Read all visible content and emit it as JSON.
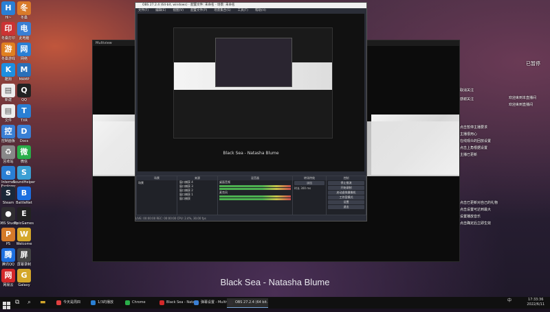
{
  "desktop_icons": [
    {
      "label": "Hi~",
      "color": "#2a7fd4",
      "glyph": "H",
      "icon": "app-icon"
    },
    {
      "label": "冬桑",
      "color": "#d97a2a",
      "glyph": "冬",
      "icon": "app-icon"
    },
    {
      "label": "冬桑打印",
      "color": "#c33",
      "glyph": "印",
      "icon": "app-icon"
    },
    {
      "label": "此电脑",
      "color": "#3a7fd4",
      "glyph": "电",
      "icon": "computer-icon"
    },
    {
      "label": "冬桑游戏",
      "color": "#e08020",
      "glyph": "游",
      "icon": "app-icon"
    },
    {
      "label": "网络",
      "color": "#2a7fd4",
      "glyph": "网",
      "icon": "network-icon"
    },
    {
      "label": "酷狗",
      "color": "#1d8fe0",
      "glyph": "K",
      "icon": "app-icon"
    },
    {
      "label": "MAMP",
      "color": "#2a6fb8",
      "glyph": "M",
      "icon": "app-icon"
    },
    {
      "label": "新建",
      "color": "#eeeeee",
      "glyph": "▤",
      "icon": "file-icon"
    },
    {
      "label": "QQ",
      "color": "#222",
      "glyph": "Q",
      "icon": "qq-icon"
    },
    {
      "label": "文件",
      "color": "#eeeeee",
      "glyph": "▤",
      "icon": "file-icon"
    },
    {
      "label": "TXR",
      "color": "#2a7fd4",
      "glyph": "T",
      "icon": "app-icon"
    },
    {
      "label": "控制面板",
      "color": "#3a7fd4",
      "glyph": "控",
      "icon": "control-panel-icon"
    },
    {
      "label": "Docs",
      "color": "#3a7fd4",
      "glyph": "D",
      "icon": "app-icon"
    },
    {
      "label": "回收站",
      "color": "#888",
      "glyph": "♻",
      "icon": "recycle-bin-icon"
    },
    {
      "label": "微信",
      "color": "#2aae4a",
      "glyph": "微",
      "icon": "wechat-icon"
    },
    {
      "label": "Internet Explorer",
      "color": "#2a7fd4",
      "glyph": "e",
      "icon": "ie-icon"
    },
    {
      "label": "SoundHelper",
      "color": "#3a9fd4",
      "glyph": "S",
      "icon": "app-icon"
    },
    {
      "label": "Steam",
      "color": "#1b2838",
      "glyph": "S",
      "icon": "steam-icon"
    },
    {
      "label": "BattleNet",
      "color": "#1d6fe0",
      "glyph": "B",
      "icon": "app-icon"
    },
    {
      "label": "OBS Studio",
      "color": "#302e31",
      "glyph": "●",
      "icon": "obs-icon"
    },
    {
      "label": "EpicGames",
      "color": "#222",
      "glyph": "E",
      "icon": "epic-icon"
    },
    {
      "label": "PS",
      "color": "#d47a2a",
      "glyph": "P",
      "icon": "app-icon"
    },
    {
      "label": "Welcome",
      "color": "#d4a72a",
      "glyph": "W",
      "icon": "app-icon"
    },
    {
      "label": "腾讯QQ",
      "color": "#1d6fe0",
      "glyph": "腾",
      "icon": "app-icon"
    },
    {
      "label": "屏幕录制",
      "color": "#444",
      "glyph": "屏",
      "icon": "app-icon"
    },
    {
      "label": "网易云",
      "color": "#d4292a",
      "glyph": "网",
      "icon": "netease-icon"
    },
    {
      "label": "Galaxy",
      "color": "#d4a72a",
      "glyph": "G",
      "icon": "app-icon"
    }
  ],
  "projector": {
    "title": "Multiview"
  },
  "obs": {
    "title": "OBS 27.2.4 (64-bit, windows) - 配置文件: 未命名 - 场景: 未命名",
    "menu": [
      "文件(F)",
      "编辑(E)",
      "视图(V)",
      "配置文件(P)",
      "场景集合(S)",
      "工具(T)",
      "帮助(H)"
    ],
    "inner_caption": "Black Sea - Natasha Blume",
    "docks": [
      "场景",
      "来源",
      "混音器",
      "转场特效",
      "控制"
    ],
    "scene_item": "场景",
    "sources": [
      "窗口捕获 4",
      "窗口捕获 3",
      "窗口捕获 2",
      "窗口捕获 1",
      "窗口捕获"
    ],
    "mixer": [
      "桌面音频",
      "麦克风"
    ],
    "transition": {
      "name": "淡出",
      "duration_label": "时长",
      "duration": "300 ms"
    },
    "controls": [
      "停止推流",
      "开始录制",
      "启动虚拟摄像机",
      "工作室模式",
      "设置",
      "退出"
    ],
    "status": "LIVE: 00:00:00  REC: 00:00:00  CPU: 2.4%, 30.00 fps"
  },
  "chat": [
    "已暂停",
    "取消关注",
    "欢迎来到本直播间",
    "感谢关注",
    "欢迎来到直播间",
    "点击暂停主播要求",
    "主播很用心",
    "在线观众的回放设置",
    "点击上角根据设置",
    "主播已更新",
    "点击已更新对自己的礼物",
    "点击设置可达到最大",
    "设置播放音乐",
    "点击确定后立即生效"
  ],
  "caption": "Black Sea - Natasha Blume",
  "taskbar": {
    "items": [
      {
        "label": "今天是周四",
        "color": "#e04040",
        "active": false
      },
      {
        "label": "1/3的播放",
        "color": "#2a7fd4",
        "active": false
      },
      {
        "label": "Chrome",
        "color": "#2aae4a",
        "active": false
      },
      {
        "label": "Black Sea - Natas…",
        "color": "#d4292a",
        "active": false
      },
      {
        "label": "弹幕设置 - Multiv…",
        "color": "#3a7fd4",
        "active": false
      },
      {
        "label": "OBS 27.2.4 (64 bit…",
        "color": "#302e31",
        "active": true
      }
    ],
    "time": "17:33:36",
    "date": "2022/6/11",
    "lang": "中"
  }
}
